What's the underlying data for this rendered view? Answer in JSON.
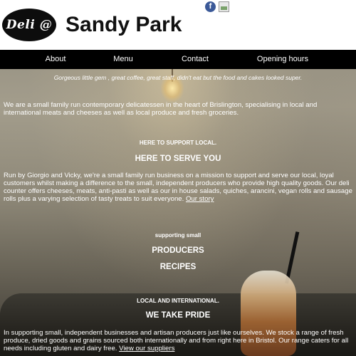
{
  "header": {
    "logo_text": "Deli @",
    "title": "Sandy Park"
  },
  "social": {
    "facebook_glyph": "f"
  },
  "nav": {
    "items": [
      "About",
      "Menu",
      "Contact",
      "Opening hours"
    ]
  },
  "tagline": "Gorgeous little gem , great coffee, great staff, didn't eat but the food and cakes looked super.",
  "intro": "We are a small family run contemporary delicatessen in the heart of Brislington, specialising in local and international meats and cheeses as well as local produce and fresh groceries.",
  "support_local": {
    "kicker": "HERE TO SUPPORT LOCAL.",
    "heading": "HERE TO SERVE YOU",
    "body": "Run by Giorgio and Vicky, we're a small family run business on a mission to support and serve our local, loyal customers whilst making a difference to the small, independent producers who provide high quality goods. Our deli counter offers cheeses, meats, anti-pasti as well as our in house salads, quiches, arancini, vegan rolls and sausage rolls plus a varying selection of tasty treats to suit everyone.",
    "link": "Our story"
  },
  "producers": {
    "kicker": "supporting small",
    "heading1": "PRODUCERS",
    "heading2": "RECIPES"
  },
  "pride": {
    "kicker": "LOCAL AND INTERNATIONAL.",
    "heading": "WE TAKE PRIDE",
    "body": "In supporting small, independent businesses and artisan producers just like ourselves. We stock a range of fresh produce, dried goods and grains sourced both internationally and from right here in Bristol. Our range caters for all needs including gluten and dairy free.",
    "link": "View our suppliers"
  },
  "icons": [
    "facebook-icon",
    "image-icon"
  ],
  "colors": {
    "header_bg": "#ffffff",
    "nav_bg": "#000000",
    "logo_bg": "#0d0d0d",
    "facebook": "#3b5998"
  }
}
